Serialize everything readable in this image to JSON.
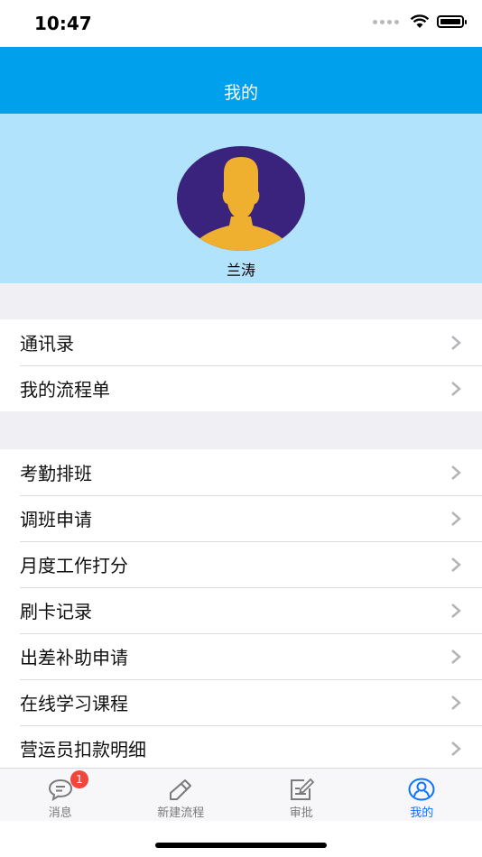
{
  "status_bar": {
    "time": "10:47"
  },
  "header": {
    "title": "我的"
  },
  "profile": {
    "name": "兰涛"
  },
  "group1": [
    {
      "label": "通讯录"
    },
    {
      "label": "我的流程单"
    }
  ],
  "group2": [
    {
      "label": "考勤排班"
    },
    {
      "label": "调班申请"
    },
    {
      "label": "月度工作打分"
    },
    {
      "label": "刷卡记录"
    },
    {
      "label": "出差补助申请"
    },
    {
      "label": "在线学习课程"
    },
    {
      "label": "营运员扣款明细"
    }
  ],
  "tabs": [
    {
      "label": "消息",
      "icon": "message-icon",
      "badge": "1"
    },
    {
      "label": "新建流程",
      "icon": "pencil-icon"
    },
    {
      "label": "审批",
      "icon": "edit-doc-icon"
    },
    {
      "label": "我的",
      "icon": "user-circle-icon",
      "active": true
    }
  ],
  "colors": {
    "header": "#00a0ec",
    "profile_bg": "#b1e3fc",
    "active_tab": "#0a73ff",
    "badge": "#f0463c"
  }
}
